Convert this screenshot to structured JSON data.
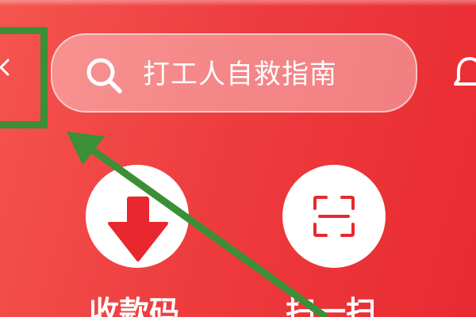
{
  "search": {
    "placeholder": "打工人自救指南"
  },
  "actions": [
    {
      "label": "收款码",
      "icon": "receive-money-icon"
    },
    {
      "label": "扫一扫",
      "icon": "scan-icon"
    }
  ],
  "colors": {
    "background_start": "#f4554f",
    "background_end": "#e82a31",
    "accent_red": "#e8282e",
    "annotation_green": "#3a8f37",
    "button_bg": "#ffffff"
  },
  "icons": {
    "top_left": "chevron-left-icon",
    "search": "search-icon",
    "top_right": "bell-icon"
  }
}
